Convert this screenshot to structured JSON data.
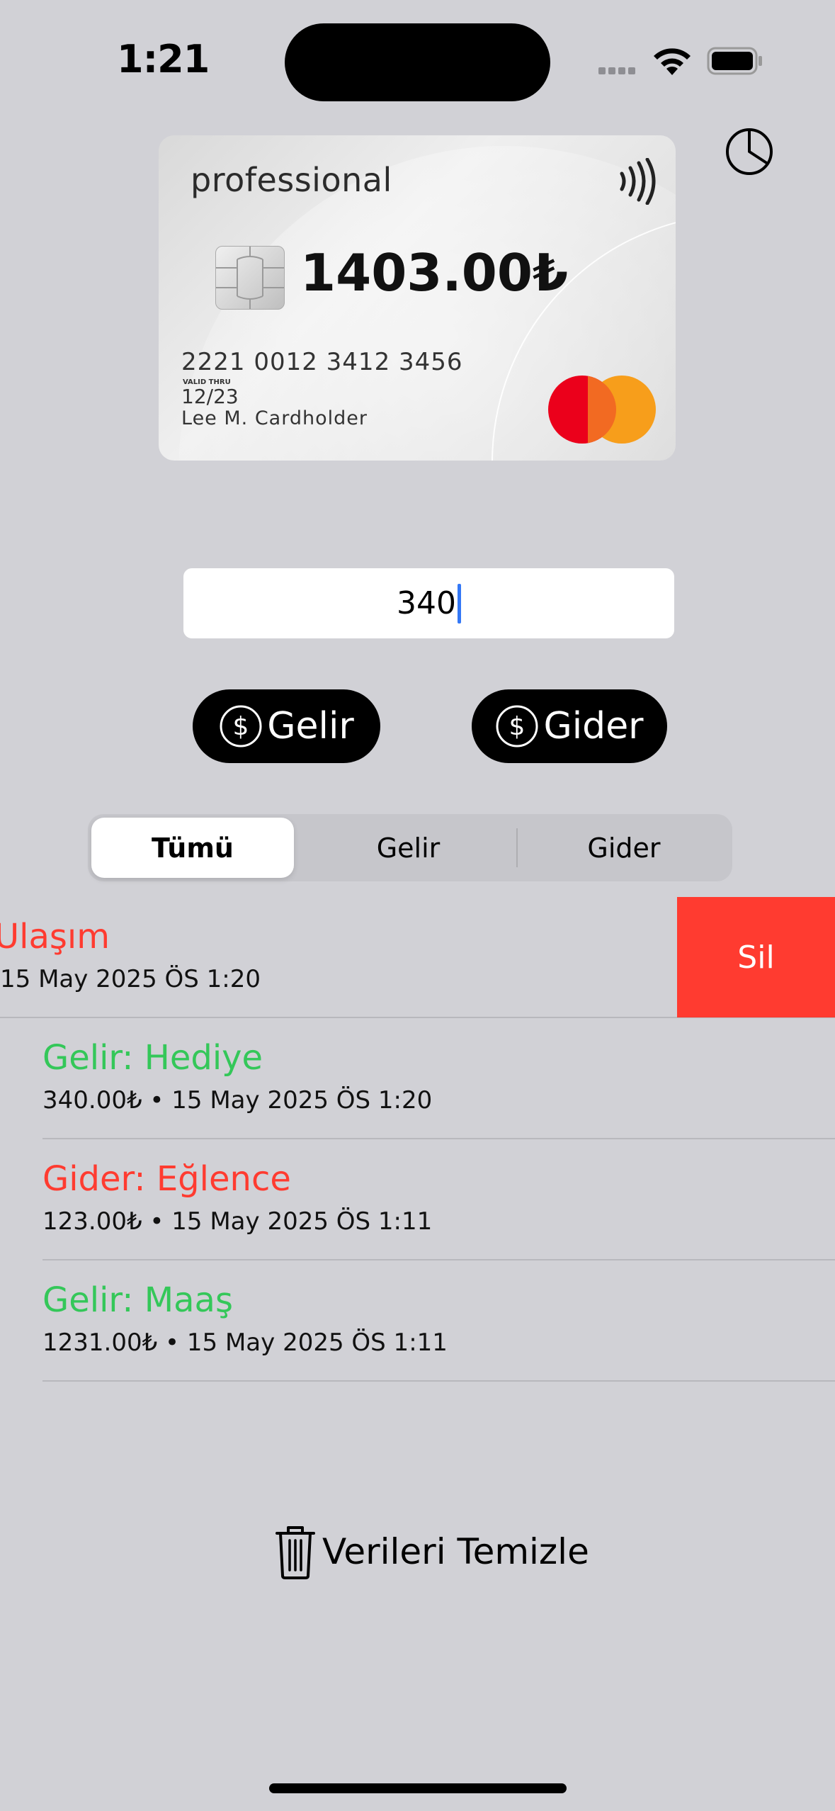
{
  "status_bar": {
    "time": "1:21"
  },
  "card": {
    "brand": "professional",
    "balance": "1403.00₺",
    "number": "2221 0012 3412 3456",
    "valid_thru_label": "VALID THRU",
    "expiry": "12/23",
    "holder": "Lee M. Cardholder",
    "network_icon": "mastercard-logo"
  },
  "header": {
    "chart_icon": "pie-chart-icon"
  },
  "amount_input": {
    "value": "340"
  },
  "actions": {
    "income_label": "Gelir",
    "expense_label": "Gider",
    "icon": "dollar-circle-icon"
  },
  "filter": {
    "segments": [
      "Tümü",
      "Gelir",
      "Gider"
    ],
    "selected": "Tümü"
  },
  "transactions": [
    {
      "title": "Ulaşım",
      "subtitle": "15 May 2025 ÖS 1:20",
      "type": "expense",
      "swiped": true
    },
    {
      "title": "Gelir: Hediye",
      "subtitle": "340.00₺ • 15 May 2025 ÖS 1:20",
      "type": "income"
    },
    {
      "title": "Gider: Eğlence",
      "subtitle": "123.00₺ • 15 May 2025 ÖS 1:11",
      "type": "expense"
    },
    {
      "title": "Gelir: Maaş",
      "subtitle": "1231.00₺ • 15 May 2025 ÖS 1:11",
      "type": "income"
    }
  ],
  "swipe_action": {
    "delete_label": "Sil"
  },
  "clear_button": {
    "label": "Verileri Temizle",
    "icon": "trash-icon"
  },
  "colors": {
    "income": "#34c759",
    "expense": "#ff3b30",
    "background": "#d1d1d6"
  }
}
